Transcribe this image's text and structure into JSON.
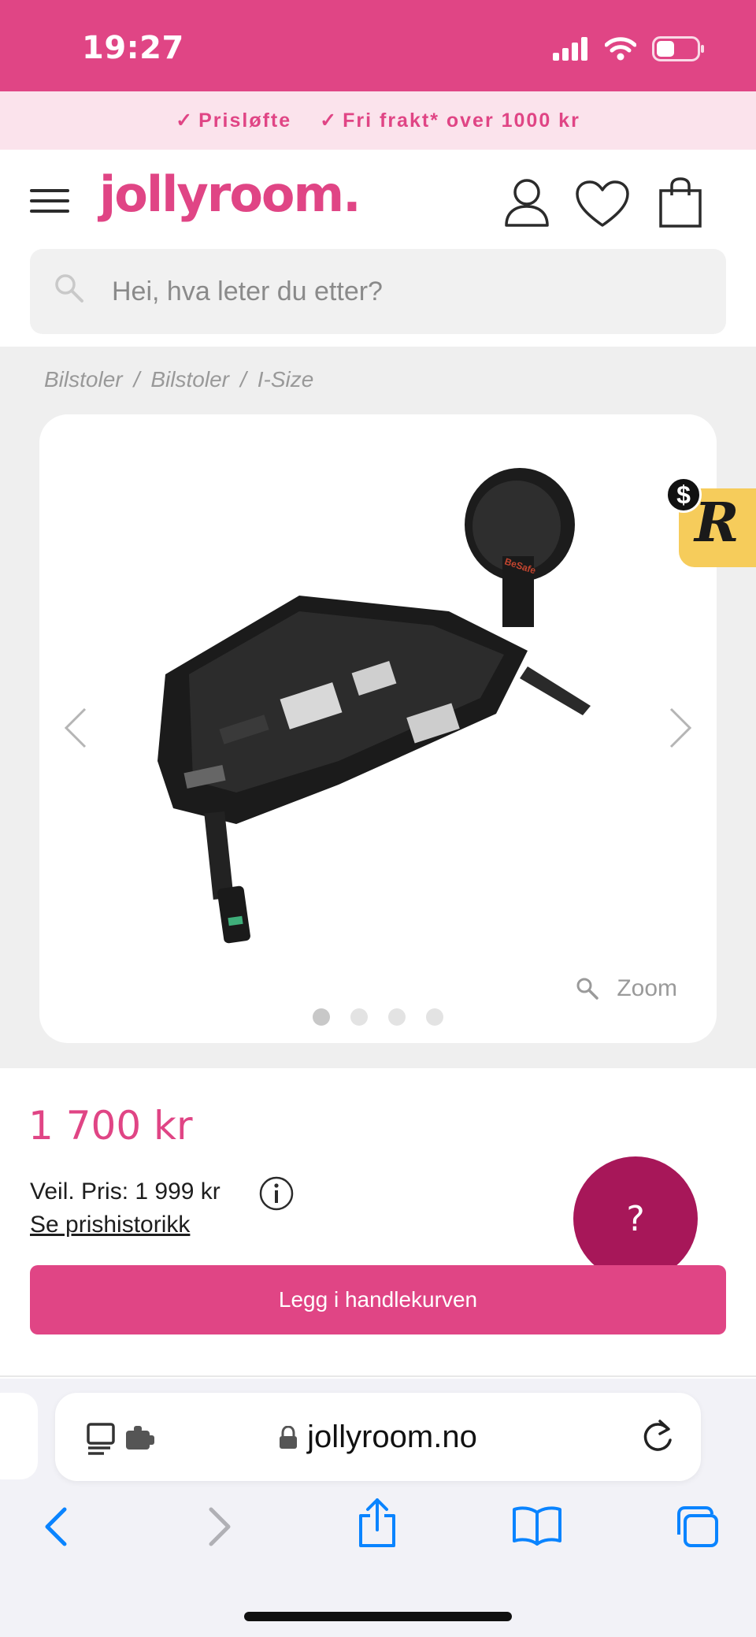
{
  "status_bar": {
    "time": "19:27"
  },
  "usp": {
    "items": [
      "Prisløfte",
      "Fri frakt* over 1000 kr"
    ]
  },
  "header": {
    "logo": "jollyroom."
  },
  "search": {
    "placeholder": "Hei, hva leter du etter?"
  },
  "breadcrumb": [
    "Bilstoler",
    "Bilstoler",
    "I-Size"
  ],
  "gallery": {
    "zoom_label": "Zoom",
    "image_count": 4,
    "active_index": 0,
    "product_brand_mark": "BeSafe"
  },
  "rewards": {
    "letter": "R",
    "dollar": "$"
  },
  "product": {
    "price": "1 700 kr",
    "rrp": "Veil. Pris: 1 999 kr",
    "price_history_link": "Se prishistorikk",
    "add_to_cart": "Legg i handlekurven"
  },
  "help": {
    "label": "?"
  },
  "browser": {
    "url": "jollyroom.no"
  },
  "colors": {
    "brand": "#e04585",
    "brand_dark": "#a71759",
    "usp_bg": "#fbe3ec",
    "ios_blue": "#0a84ff"
  }
}
